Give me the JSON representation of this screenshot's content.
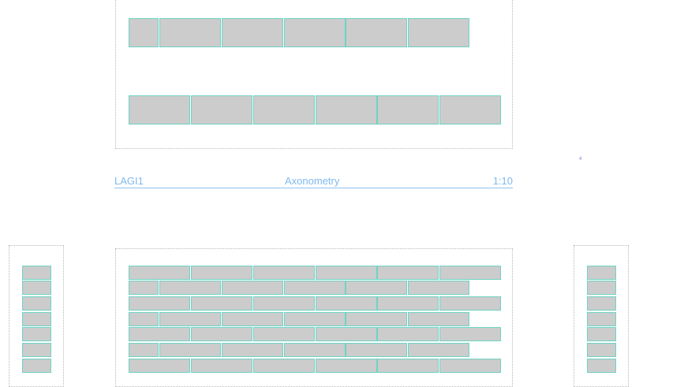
{
  "drawing_label": {
    "left": "LAGI1",
    "center": "Axonometry",
    "right": "1:10"
  },
  "marker_glyph": "4",
  "colors": {
    "brick_fill": "#cccccc",
    "brick_stroke": "#6fd3c4",
    "label_text": "#7fb9ee",
    "frame_dots": "#b8b8b8"
  }
}
